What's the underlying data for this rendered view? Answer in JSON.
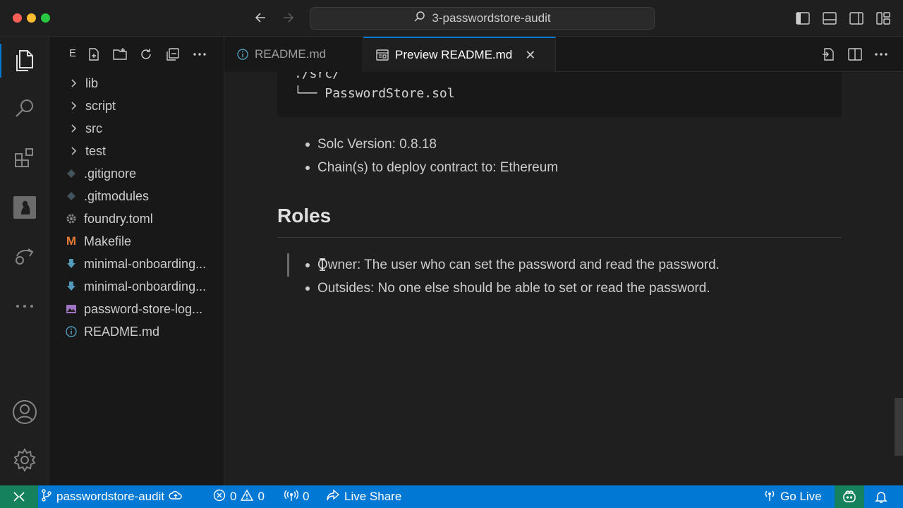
{
  "window": {
    "search_title": "3-passwordstore-audit"
  },
  "sidebar": {
    "title_abbrev": "E",
    "items": [
      {
        "label": "lib",
        "type": "folder"
      },
      {
        "label": "script",
        "type": "folder"
      },
      {
        "label": "src",
        "type": "folder"
      },
      {
        "label": "test",
        "type": "folder"
      },
      {
        "label": ".gitignore",
        "type": "file",
        "icon": "git-icon"
      },
      {
        "label": ".gitmodules",
        "type": "file",
        "icon": "git-icon"
      },
      {
        "label": "foundry.toml",
        "type": "file",
        "icon": "gear-icon"
      },
      {
        "label": "Makefile",
        "type": "file",
        "icon": "makefile-icon",
        "icon_glyph": "M"
      },
      {
        "label": "minimal-onboarding...",
        "type": "file",
        "icon": "download-icon"
      },
      {
        "label": "minimal-onboarding...",
        "type": "file",
        "icon": "download-icon"
      },
      {
        "label": "password-store-log...",
        "type": "file",
        "icon": "image-icon"
      },
      {
        "label": "README.md",
        "type": "file",
        "icon": "info-icon"
      }
    ]
  },
  "tabs": [
    {
      "label": "README.md",
      "active": false
    },
    {
      "label": "Preview README.md",
      "active": true
    }
  ],
  "preview": {
    "code_line1": "./src/",
    "code_tree": "└──",
    "code_file": "PasswordStore.sol",
    "scope_bullets": [
      "Solc Version: 0.8.18",
      "Chain(s) to deploy contract to: Ethereum"
    ],
    "roles_heading": "Roles",
    "roles_bullets": [
      "Owner: The user who can set the password and read the password.",
      "Outsides: No one else should be able to set or read the password."
    ]
  },
  "statusbar": {
    "branch": "passwordstore-audit",
    "errors": "0",
    "warnings": "0",
    "ports": "0",
    "live_share": "Live Share",
    "go_live": "Go Live"
  },
  "colors": {
    "accent": "#0078d4",
    "remote": "#16825d"
  }
}
